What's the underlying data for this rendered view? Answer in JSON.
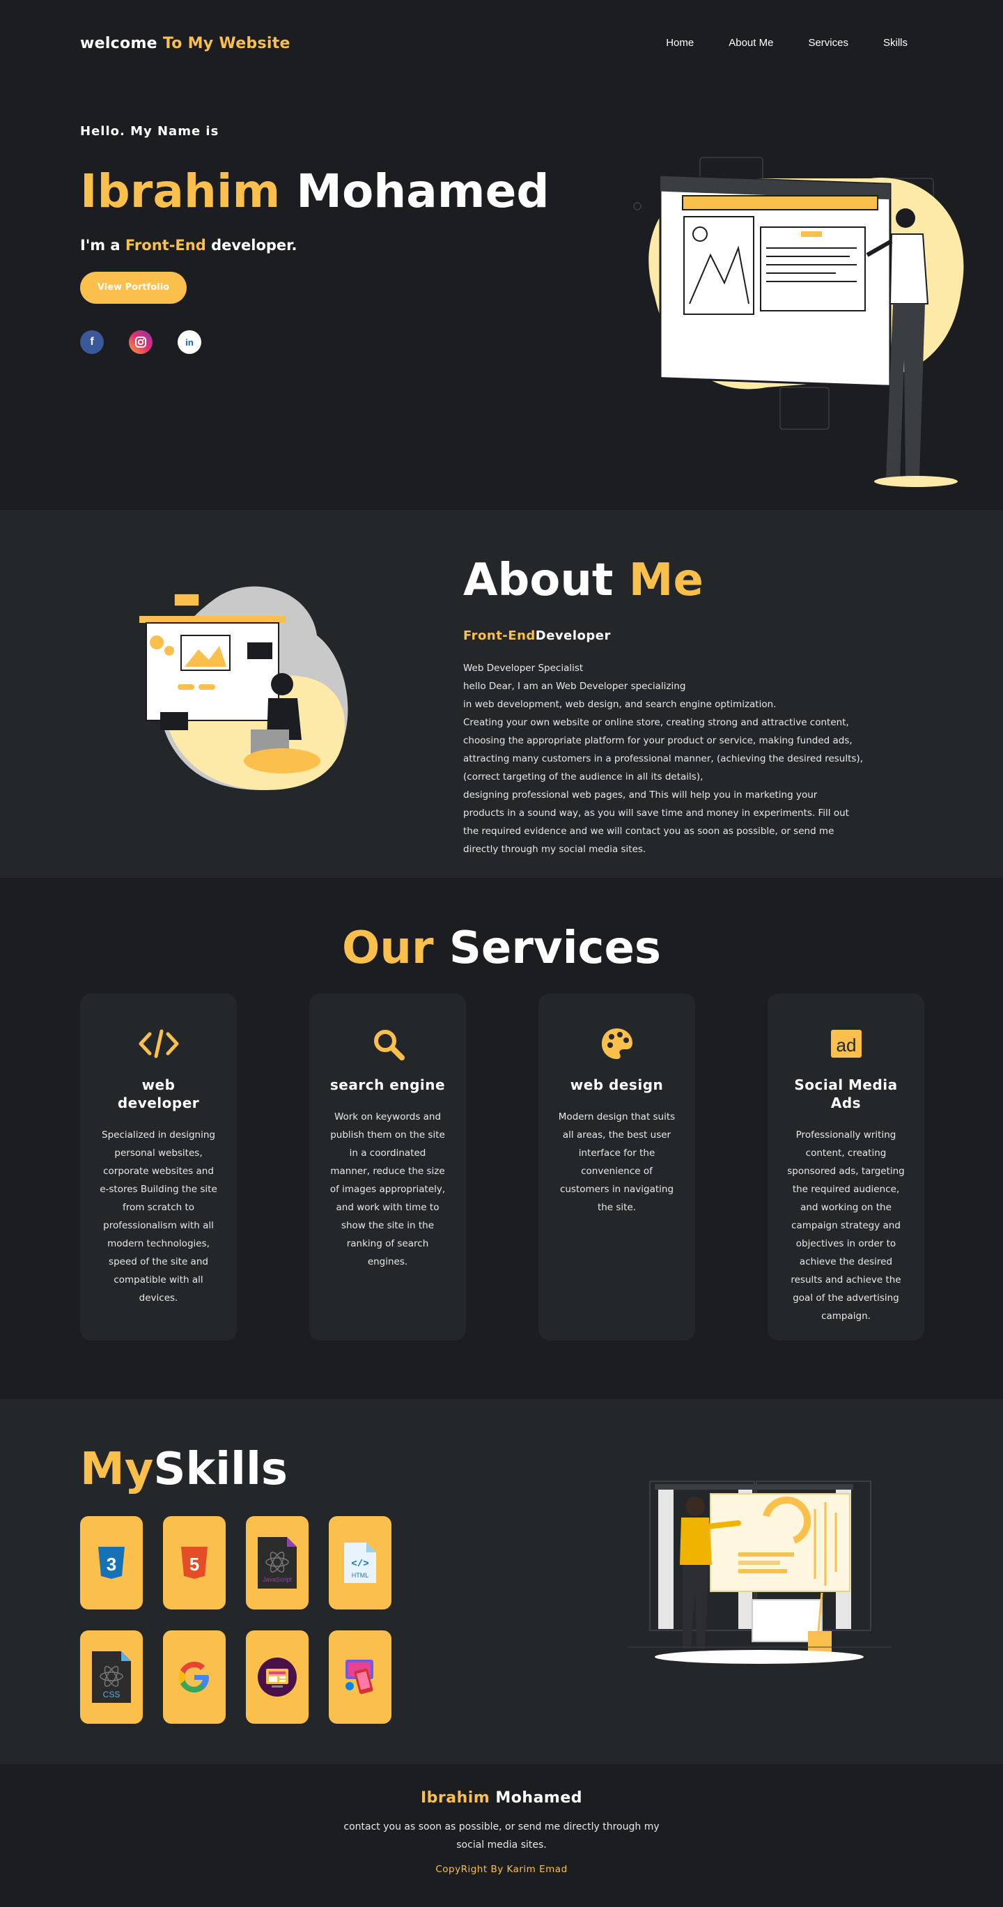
{
  "header": {
    "logo_white": "welcome",
    "logo_accent": "To My Website",
    "nav": [
      "Home",
      "About Me",
      "Services",
      "Skills"
    ]
  },
  "hero": {
    "hello": "Hello. My Name is",
    "first_name": "Ibrahim",
    "last_name": "Mohamed",
    "tag_pre": "I'm a",
    "tag_accent": "Front-End",
    "tag_post": "developer.",
    "button": "View Portfolio",
    "socials": [
      "facebook-icon",
      "instagram-icon",
      "linkedin-icon"
    ]
  },
  "about": {
    "title_white": "About",
    "title_accent": "Me",
    "sub_accent": "Front-End",
    "sub_white": "Developer",
    "lines": [
      "Web Developer Specialist",
      "hello Dear, I am an Web Developer specializing",
      "in web development, web design, and search engine optimization.",
      "Creating your own website or online store, creating strong and attractive content,",
      "choosing the appropriate platform for your product or service, making funded ads,",
      "attracting many customers in a professional manner, (achieving the desired results),",
      "(correct targeting of the audience in all its details),",
      "designing professional web pages, and This will help you in marketing your",
      "products in a sound way, as you will save time and money in experiments. Fill out",
      "the required evidence and we will contact you as soon as possible, or send me",
      "directly through my social media sites."
    ]
  },
  "services": {
    "title_accent": "Our",
    "title_white": "Services",
    "cards": [
      {
        "icon": "code-icon",
        "title": "web developer",
        "text": "Specialized in designing personal websites, corporate websites and e-stores Building the site from scratch to professionalism with all modern technologies, speed of the site and compatible with all devices."
      },
      {
        "icon": "search-icon",
        "title": "search engine",
        "text": "Work on keywords and publish them on the site in a coordinated manner, reduce the size of images appropriately, and work with time to show the site in the ranking of search engines."
      },
      {
        "icon": "palette-icon",
        "title": "web design",
        "text": "Modern design that suits all areas, the best user interface for the convenience of customers in navigating the site."
      },
      {
        "icon": "ad-icon",
        "title": "Social Media Ads",
        "text": "Professionally writing content, creating sponsored ads, targeting the required audience, and working on the campaign strategy and objectives in order to achieve the desired results and achieve the goal of the advertising campaign."
      }
    ]
  },
  "skills": {
    "title_accent": "My",
    "title_white": "Skills",
    "tiles": [
      "css3-icon",
      "html5-icon",
      "javascript-file-icon",
      "html-file-icon",
      "css-file-icon",
      "google-icon",
      "web-design-icon",
      "responsive-design-icon"
    ],
    "js_label": "JavaScript",
    "html_label": "HTML",
    "css_label": "CSS"
  },
  "footer": {
    "first_name": "Ibrahim",
    "last_name": "Mohamed",
    "text": "contact you as soon as possible, or send me directly through my social media sites.",
    "copyright": "CopyRight By Karim Emad"
  },
  "colors": {
    "accent": "#fbbf4c",
    "background": "#1b1d20",
    "panel": "#24272a"
  }
}
